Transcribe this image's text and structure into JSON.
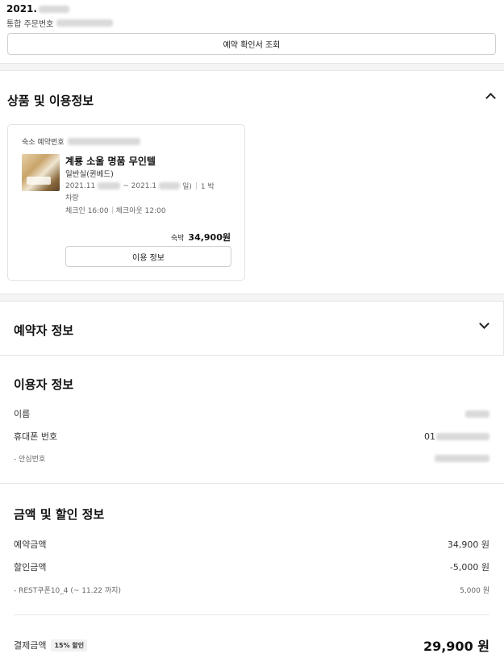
{
  "order": {
    "date_prefix": "2021.",
    "order_no_label": "통합 주문번호",
    "receipt_button": "예약 확인서 조회"
  },
  "product": {
    "section_title": "상품 및 이용정보",
    "reservation_no_label": "숙소 예약번호",
    "hotel_name": "계룡 소울 명품 무인텔",
    "room_type": "일반실(퀸베드)",
    "checkin_date_prefix": "2021.11",
    "checkout_date_prefix": "~ 2021.1",
    "date_close": "일)",
    "nights": "1 박",
    "vehicle": "차량",
    "checkin": "체크인 16:00",
    "checkout": "체크아웃 12:00",
    "price_label": "숙박",
    "price": "34,900원",
    "use_info_button": "이용 정보"
  },
  "booker": {
    "section_title": "예약자 정보"
  },
  "user": {
    "section_title": "이용자 정보",
    "name_label": "이름",
    "phone_label": "휴대폰 번호",
    "phone_prefix": "01",
    "safe_no_label": "- 안심번호"
  },
  "amount": {
    "section_title": "금액 및 할인 정보",
    "booking_amount_label": "예약금액",
    "booking_amount": "34,900 원",
    "discount_label": "할인금액",
    "discount": "-5,000 원",
    "coupon_label": "- REST쿠폰10_4 (~ 11.22 까지)",
    "coupon_amount": "5,000 원",
    "total_label": "결제금액",
    "discount_badge": "15% 할인",
    "total": "29,900 원"
  },
  "icons": {
    "collapse": "chevron-up-icon",
    "expand": "chevron-down-icon"
  }
}
